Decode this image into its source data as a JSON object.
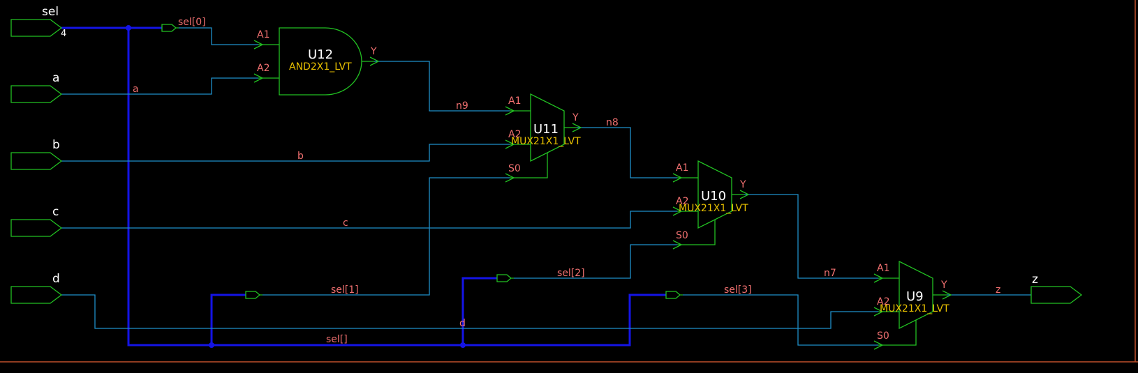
{
  "ports": {
    "sel": "sel",
    "sel_width": "4",
    "a": "a",
    "b": "b",
    "c": "c",
    "d": "d",
    "z": "z"
  },
  "cells": {
    "u12": {
      "name": "U12",
      "type": "AND2X1_LVT",
      "pins": {
        "a1": "A1",
        "a2": "A2",
        "y": "Y"
      }
    },
    "u11": {
      "name": "U11",
      "type": "MUX21X1_LVT",
      "pins": {
        "a1": "A1",
        "a2": "A2",
        "s0": "S0",
        "y": "Y"
      }
    },
    "u10": {
      "name": "U10",
      "type": "MUX21X1_LVT",
      "pins": {
        "a1": "A1",
        "a2": "A2",
        "s0": "S0",
        "y": "Y"
      }
    },
    "u9": {
      "name": "U9",
      "type": "MUX21X1_LVT",
      "pins": {
        "a1": "A1",
        "a2": "A2",
        "s0": "S0",
        "y": "Y"
      }
    }
  },
  "nets": {
    "sel0": "sel[0]",
    "sel1": "sel[1]",
    "sel2": "sel[2]",
    "sel3": "sel[3]",
    "sel_bus": "sel[]",
    "a": "a",
    "b": "b",
    "c": "c",
    "d": "d",
    "n9": "n9",
    "n8": "n8",
    "n7": "n7",
    "z": "z"
  },
  "colors": {
    "background": "#000000",
    "wire": "#1f8fc9",
    "bus": "#1414e6",
    "cell_outline": "#22c022",
    "net_label": "#f07070",
    "cell_type": "#e8c000",
    "border": "#c0502c"
  }
}
